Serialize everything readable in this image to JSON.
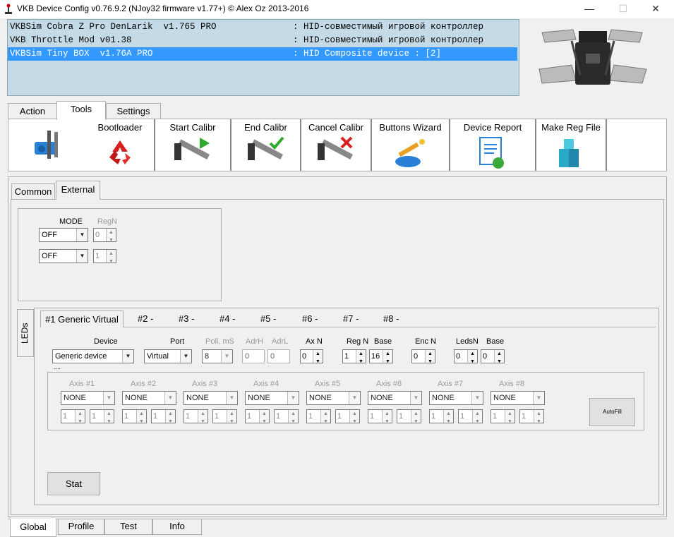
{
  "window": {
    "title": "VKB Device Config v0.76.9.2 (NJoy32 firmware v1.77+) © Alex Oz 2013-2016",
    "minimize": "—",
    "maximize": "☐",
    "close": "✕"
  },
  "devices": [
    {
      "name": "VKBSim Cobra Z Pro DenLarik  v1.765 PRO",
      "desc": ": HID-совместимый игровой контроллер"
    },
    {
      "name": "VKB Throttle Mod v01.38",
      "desc": ": HID-совместимый игровой контроллер"
    },
    {
      "name": "VKBSim Tiny BOX  v1.76A PRO",
      "desc": ": HID Composite device : [2]"
    }
  ],
  "main_tabs": [
    "Action",
    "Tools",
    "Settings"
  ],
  "toolbar": {
    "bootloader": "Bootloader",
    "start_calibr": "Start Calibr",
    "end_calibr": "End Calibr",
    "cancel_calibr": "Cancel Calibr",
    "buttons_wizard": "Buttons Wizard",
    "device_report": "Device Report",
    "make_reg_file": "Make Reg File"
  },
  "sub_tabs": [
    "Common",
    "External"
  ],
  "mode_group": {
    "mode_label": "MODE",
    "regn_label": "RegN",
    "rows": [
      {
        "mode": "OFF",
        "regn": "0"
      },
      {
        "mode": "OFF",
        "regn": "1"
      }
    ]
  },
  "side_tab": "LEDs",
  "ext_tabs": [
    "#1 Generic Virtual",
    "#2 -",
    "#3 -",
    "#4 -",
    "#5 -",
    "#6 -",
    "#7 -",
    "#8 -"
  ],
  "ext": {
    "labels": {
      "device": "Device",
      "port": "Port",
      "poll": "Poll, mS",
      "adrh": "AdrH",
      "adrl": "AdrL",
      "axn": "Ax N",
      "regn": "Reg N",
      "base": "Base",
      "encn": "Enc N",
      "ledsn": "LedsN",
      "base2": "Base"
    },
    "values": {
      "device": "Generic device",
      "port": "Virtual",
      "poll": "8",
      "adrh": "0",
      "adrl": "0",
      "axn": "0",
      "regn": "1",
      "base": "16",
      "encn": "0",
      "ledsn": "0",
      "base2": "0"
    },
    "dots": "....",
    "axes": [
      {
        "label": "Axis #1",
        "value": "NONE",
        "a": "1",
        "b": "1"
      },
      {
        "label": "Axis #2",
        "value": "NONE",
        "a": "1",
        "b": "1"
      },
      {
        "label": "Axis #3",
        "value": "NONE",
        "a": "1",
        "b": "1"
      },
      {
        "label": "Axis #4",
        "value": "NONE",
        "a": "1",
        "b": "1"
      },
      {
        "label": "Axis #5",
        "value": "NONE",
        "a": "1",
        "b": "1"
      },
      {
        "label": "Axis #6",
        "value": "NONE",
        "a": "1",
        "b": "1"
      },
      {
        "label": "Axis #7",
        "value": "NONE",
        "a": "1",
        "b": "1"
      },
      {
        "label": "Axis #8",
        "value": "NONE",
        "a": "1",
        "b": "1"
      }
    ],
    "autofill": "AutoFill",
    "stat": "Stat"
  },
  "bottom_tabs": [
    "Global",
    "Profile",
    "Test",
    "Info"
  ],
  "colors": {
    "list_bg": "#c4dbe7",
    "selection": "#3399ff"
  }
}
